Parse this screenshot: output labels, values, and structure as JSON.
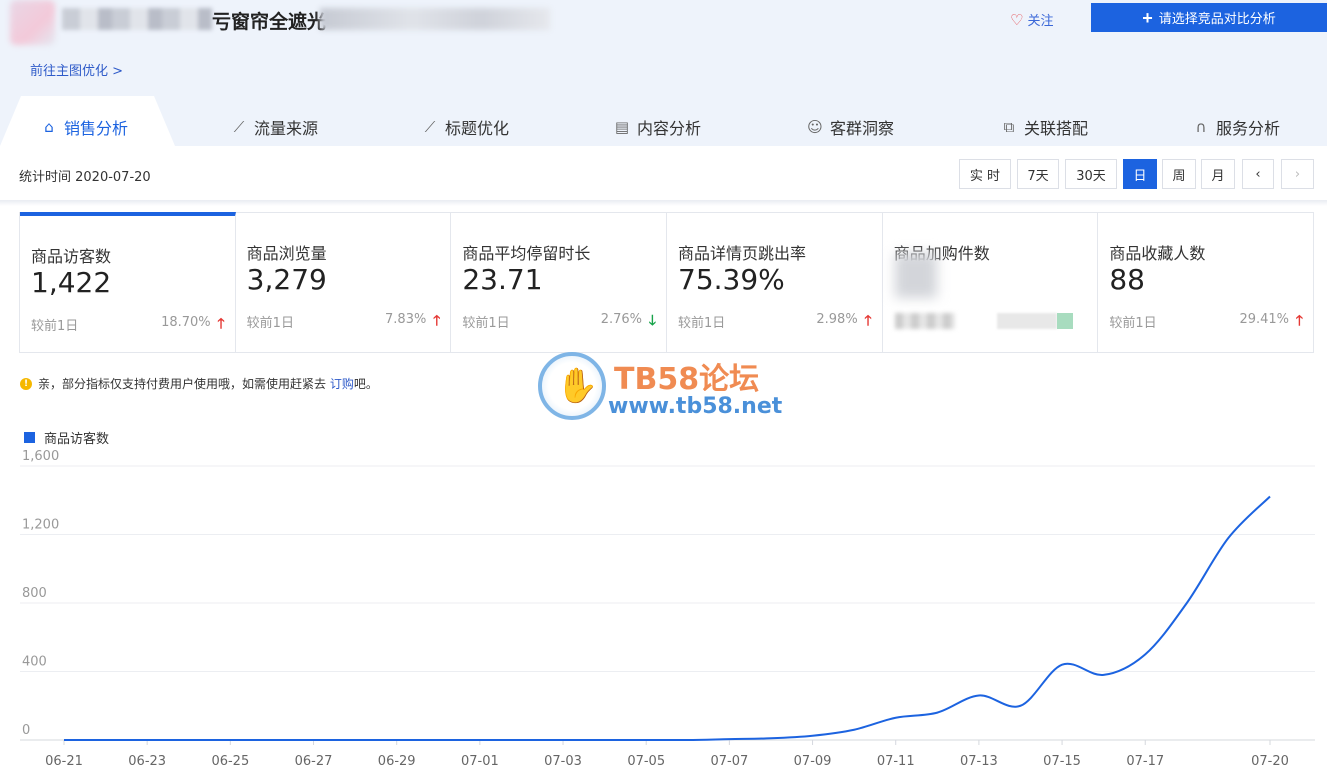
{
  "header": {
    "product_title": "窗帘全遮光",
    "product_title_prefix": "亏",
    "follow_label": "关注",
    "compare_label": "请选择竞品对比分析",
    "goto_link": "前往主图优化 >"
  },
  "tabs": [
    {
      "label": "销售分析",
      "icon": "bag-icon",
      "active": true
    },
    {
      "label": "流量来源",
      "icon": "line-chart-icon"
    },
    {
      "label": "标题优化",
      "icon": "line-chart-icon"
    },
    {
      "label": "内容分析",
      "icon": "document-icon"
    },
    {
      "label": "客群洞察",
      "icon": "users-icon"
    },
    {
      "label": "关联搭配",
      "icon": "link-icon"
    },
    {
      "label": "服务分析",
      "icon": "headset-icon"
    }
  ],
  "stat_time": "统计时间 2020-07-20",
  "periods": [
    "实 时",
    "7天",
    "30天",
    "日",
    "周",
    "月"
  ],
  "active_period": "日",
  "metrics": [
    {
      "label": "商品访客数",
      "value": "1,422",
      "compare": "较前1日",
      "pct": "18.70%",
      "trend": "up"
    },
    {
      "label": "商品浏览量",
      "value": "3,279",
      "compare": "较前1日",
      "pct": "7.83%",
      "trend": "up"
    },
    {
      "label": "商品平均停留时长",
      "value": "23.71",
      "compare": "较前1日",
      "pct": "2.76%",
      "trend": "down"
    },
    {
      "label": "商品详情页跳出率",
      "value": "75.39%",
      "compare": "较前1日",
      "pct": "2.98%",
      "trend": "up"
    },
    {
      "label": "商品加购件数",
      "value": "",
      "compare": "",
      "pct": "",
      "trend": ""
    },
    {
      "label": "商品收藏人数",
      "value": "88",
      "compare": "较前1日",
      "pct": "29.41%",
      "trend": "up"
    }
  ],
  "notice": {
    "text_before": "亲，部分指标仅支持付费用户使用哦，如需使用赶紧去",
    "link": "订购",
    "text_after": "吧。"
  },
  "watermark": {
    "title": "TB58论坛",
    "url": "www.tb58.net"
  },
  "colors": {
    "accent": "#1c63e0",
    "up": "#e53935",
    "down": "#17a34a"
  },
  "chart_data": {
    "type": "line",
    "legend": "商品访客数",
    "x": [
      "06-21",
      "06-22",
      "06-23",
      "06-24",
      "06-25",
      "06-26",
      "06-27",
      "06-28",
      "06-29",
      "06-30",
      "07-01",
      "07-02",
      "07-03",
      "07-04",
      "07-05",
      "07-06",
      "07-07",
      "07-08",
      "07-09",
      "07-10",
      "07-11",
      "07-12",
      "07-13",
      "07-14",
      "07-15",
      "07-16",
      "07-17",
      "07-18",
      "07-19",
      "07-20"
    ],
    "x_tick_labels": [
      "06-21",
      "06-23",
      "06-25",
      "06-27",
      "06-29",
      "07-01",
      "07-03",
      "07-05",
      "07-07",
      "07-09",
      "07-11",
      "07-13",
      "07-15",
      "07-17",
      "07-20"
    ],
    "series": [
      {
        "name": "商品访客数",
        "values": [
          0,
          0,
          0,
          0,
          0,
          0,
          0,
          0,
          0,
          0,
          0,
          0,
          0,
          0,
          0,
          0,
          5,
          10,
          25,
          60,
          130,
          160,
          260,
          200,
          440,
          380,
          500,
          800,
          1180,
          1422
        ]
      }
    ],
    "ylim": [
      0,
      1600
    ],
    "yticks": [
      "0",
      "400",
      "800",
      "1,200",
      "1,600"
    ],
    "grid": true
  }
}
